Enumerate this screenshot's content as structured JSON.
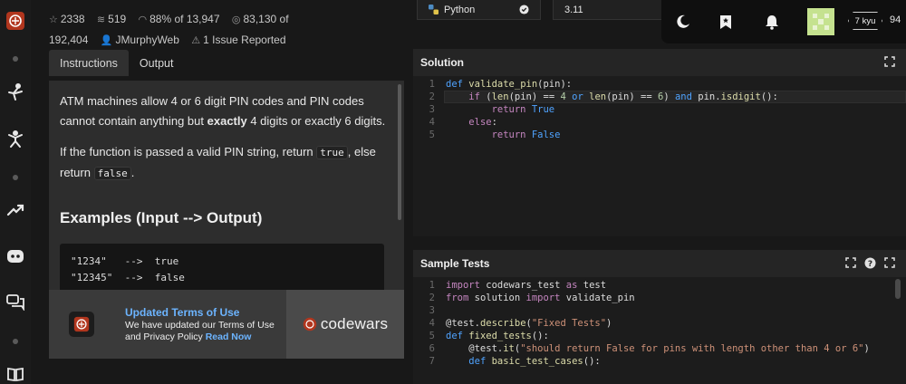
{
  "stats": {
    "stars": "2338",
    "collections": "519",
    "satisfaction": "88% of 13,947",
    "completed_prefix": "83,130 of",
    "completed_total": "192,404",
    "author": "JMurphyWeb",
    "issues": "1 Issue Reported"
  },
  "tabs": {
    "instructions": "Instructions",
    "output": "Output"
  },
  "description": {
    "p1_a": "ATM machines allow 4 or 6 digit PIN codes and PIN codes cannot contain anything but ",
    "p1_bold": "exactly",
    "p1_b": " 4 digits or exactly 6 digits.",
    "p2_a": "If the function is passed a valid PIN string, return ",
    "p2_code1": "true",
    "p2_b": ", else return ",
    "p2_code2": "false",
    "p2_c": ".",
    "examples_heading": "Examples (Input --> Output)",
    "example1": "\"1234\"   -->  true",
    "example2": "\"12345\"  -->  false"
  },
  "banner": {
    "title": "Updated Terms of Use",
    "text": "We have updated our Terms of Use and Privacy Policy",
    "link": "Read Now",
    "brand": "codewars"
  },
  "toolbar": {
    "language": "Python",
    "version": "3.11"
  },
  "user": {
    "rank": "7 kyu",
    "honor": "94"
  },
  "solution": {
    "title": "Solution",
    "lines": [
      {
        "n": "1",
        "t": "def validate_pin(pin):"
      },
      {
        "n": "2",
        "t": "    if (len(pin) == 4 or len(pin) == 6) and pin.isdigit():"
      },
      {
        "n": "3",
        "t": "        return True"
      },
      {
        "n": "4",
        "t": "    else:"
      },
      {
        "n": "5",
        "t": "        return False"
      }
    ]
  },
  "tests": {
    "title": "Sample Tests",
    "lines": [
      {
        "n": "1",
        "t": "import codewars_test as test"
      },
      {
        "n": "2",
        "t": "from solution import validate_pin"
      },
      {
        "n": "3",
        "t": ""
      },
      {
        "n": "4",
        "t": "@test.describe(\"Fixed Tests\")"
      },
      {
        "n": "5",
        "t": "def fixed_tests():"
      },
      {
        "n": "6",
        "t": "    @test.it(\"should return False for pins with length other than 4 or 6\")"
      },
      {
        "n": "7",
        "t": "    def basic_test_cases():"
      }
    ]
  },
  "colors": {
    "brand_red": "#b1361e",
    "accent_blue": "#6cb4ff",
    "background": "#181818"
  }
}
